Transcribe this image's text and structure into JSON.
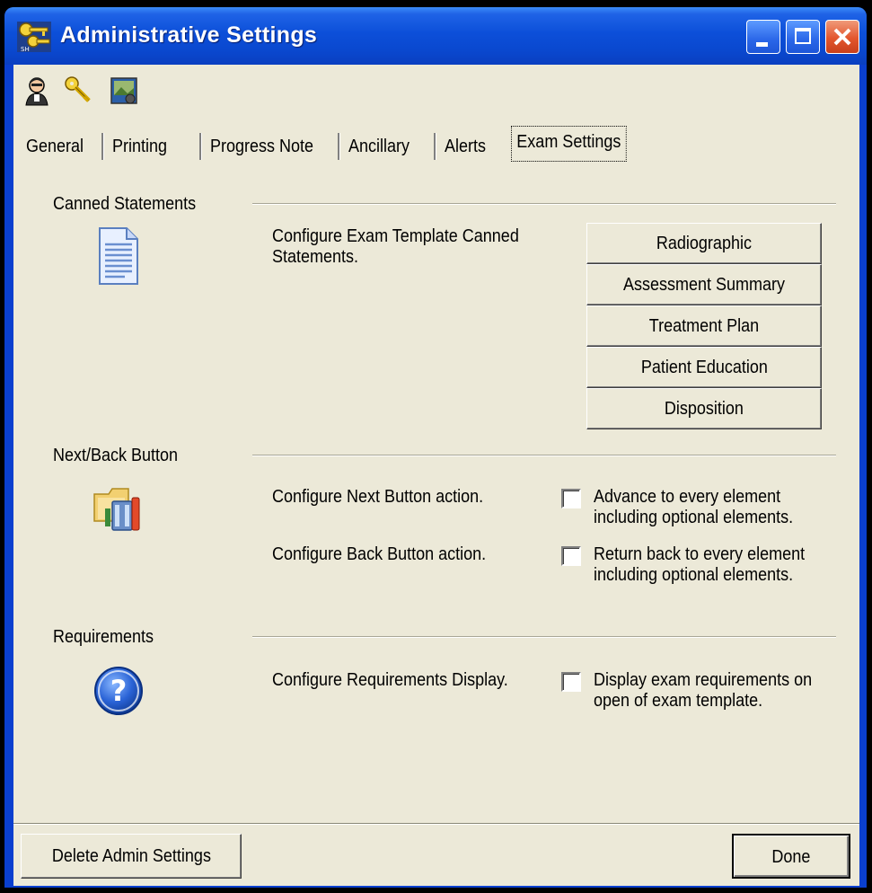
{
  "window": {
    "title": "Administrative Settings"
  },
  "toolbar": {
    "icons": [
      "user-icon",
      "key-icon",
      "settings-image-icon"
    ]
  },
  "tabs": [
    {
      "label": "General",
      "active": false
    },
    {
      "label": "Printing",
      "active": false
    },
    {
      "label": "Progress Note",
      "active": false
    },
    {
      "label": "Ancillary",
      "active": false
    },
    {
      "label": "Alerts",
      "active": false
    },
    {
      "label": "Exam Settings",
      "active": true
    }
  ],
  "canned": {
    "heading": "Canned Statements",
    "description": "Configure Exam Template Canned Statements.",
    "buttons": [
      "Radiographic",
      "Assessment Summary",
      "Treatment Plan",
      "Patient Education",
      "Disposition"
    ]
  },
  "nextback": {
    "heading": "Next/Back Button",
    "next_desc": "Configure Next Button action.",
    "next_option": "Advance to every element including optional elements.",
    "next_checked": false,
    "back_desc": "Configure Back Button action.",
    "back_option": "Return back to every element including optional elements.",
    "back_checked": false
  },
  "requirements": {
    "heading": "Requirements",
    "desc": "Configure Requirements Display.",
    "option": "Display exam requirements on open of exam template.",
    "checked": false
  },
  "footer": {
    "delete_label": "Delete Admin Settings",
    "done_label": "Done"
  },
  "colors": {
    "titlebar": "#0a48cf",
    "dialog_bg": "#ece9d8",
    "close_button": "#e3562d"
  }
}
